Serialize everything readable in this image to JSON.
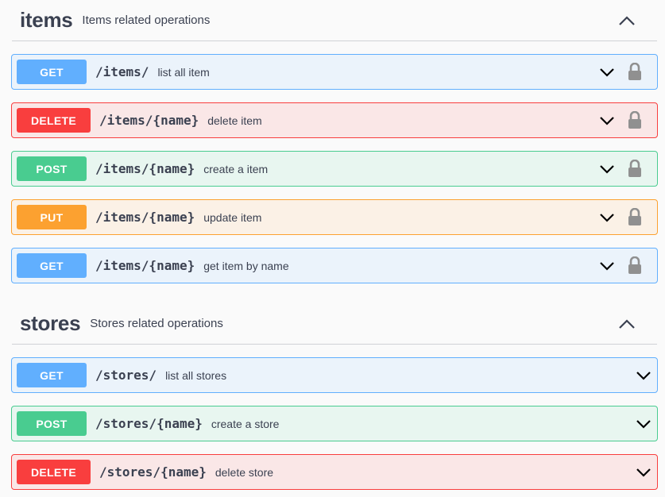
{
  "sections": [
    {
      "title": "items",
      "description": "Items related operations",
      "operations": [
        {
          "method": "GET",
          "path": "/items/",
          "summary": "list all item",
          "locked": true
        },
        {
          "method": "DELETE",
          "path": "/items/{name}",
          "summary": "delete item",
          "locked": true
        },
        {
          "method": "POST",
          "path": "/items/{name}",
          "summary": "create a item",
          "locked": true
        },
        {
          "method": "PUT",
          "path": "/items/{name}",
          "summary": "update item",
          "locked": true
        },
        {
          "method": "GET",
          "path": "/items/{name}",
          "summary": "get item by name",
          "locked": true
        }
      ]
    },
    {
      "title": "stores",
      "description": "Stores related operations",
      "operations": [
        {
          "method": "GET",
          "path": "/stores/",
          "summary": "list all stores",
          "locked": false
        },
        {
          "method": "POST",
          "path": "/stores/{name}",
          "summary": "create a store",
          "locked": false
        },
        {
          "method": "DELETE",
          "path": "/stores/{name}",
          "summary": "delete store",
          "locked": false
        }
      ]
    }
  ],
  "icons": {
    "collapse": "chevron-up-icon",
    "expand": "chevron-down-icon",
    "lock": "lock-icon"
  },
  "colors": {
    "get": "#61affe",
    "post": "#49cc90",
    "put": "#fca130",
    "delete": "#f93e3e",
    "text": "#3b4151"
  }
}
